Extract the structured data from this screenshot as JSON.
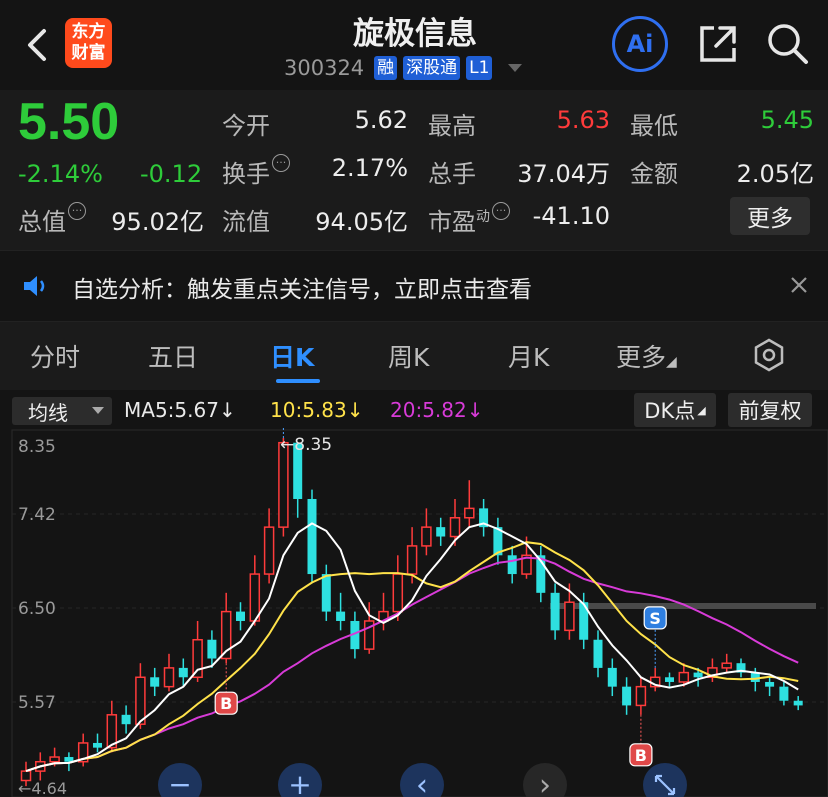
{
  "header": {
    "title": "旋极信息",
    "code": "300324",
    "tags": [
      "融",
      "深股通",
      "L1"
    ],
    "logo_lines": [
      "东方",
      "财富"
    ],
    "ai_label": "Ai"
  },
  "quote": {
    "price": "5.50",
    "change_pct": "-2.14%",
    "change_amt": "-0.12",
    "open_label": "今开",
    "open": "5.62",
    "high_label": "最高",
    "high": "5.63",
    "low_label": "最低",
    "low": "5.45",
    "turnover_label": "换手",
    "turnover": "2.17%",
    "volume_label": "总手",
    "volume": "37.04万",
    "amount_label": "金额",
    "amount": "2.05亿",
    "mcap_label": "总值",
    "mcap": "95.02亿",
    "float_label": "流值",
    "float": "94.05亿",
    "pe_label": "市盈",
    "pe_sup": "动",
    "pe": "-41.10",
    "more_label": "更多"
  },
  "banner": {
    "text": "自选分析：触发重点关注信号，立即点击查看"
  },
  "tabs": [
    "分时",
    "五日",
    "日K",
    "周K",
    "月K",
    "更多"
  ],
  "active_tab": "日K",
  "ma_bar": {
    "mode": "均线",
    "ma5": "MA5:5.67",
    "ma10": "10:5.83",
    "ma20": "20:5.82",
    "dk": "DK点",
    "adjust": "前复权"
  },
  "colors": {
    "up": "#ff3b3b",
    "down": "#2ee0e0",
    "ma5": "#ffffff",
    "ma10": "#ffe24a",
    "ma20": "#d83bd8",
    "accent": "#2f8fff"
  },
  "chart_data": {
    "type": "candlestick",
    "y_ticks": [
      "8.35",
      "7.42",
      "6.50",
      "5.57"
    ],
    "ylim": [
      4.62,
      8.35
    ],
    "max_label": "8.35",
    "min_label": "4.64",
    "signals": [
      {
        "type": "B",
        "index": 14
      },
      {
        "type": "S",
        "index": 18
      },
      {
        "type": "B",
        "index": 43
      },
      {
        "type": "S",
        "index": 44
      }
    ],
    "candles": [
      [
        4.7,
        4.8,
        4.9,
        4.64
      ],
      [
        4.8,
        4.9,
        5.0,
        4.7
      ],
      [
        4.9,
        4.95,
        5.05,
        4.85
      ],
      [
        4.95,
        4.9,
        5.0,
        4.8
      ],
      [
        4.9,
        5.1,
        5.2,
        4.85
      ],
      [
        5.1,
        5.05,
        5.2,
        5.0
      ],
      [
        5.05,
        5.4,
        5.55,
        5.0
      ],
      [
        5.4,
        5.3,
        5.5,
        5.2
      ],
      [
        5.3,
        5.8,
        5.95,
        5.25
      ],
      [
        5.8,
        5.7,
        5.9,
        5.6
      ],
      [
        5.7,
        5.9,
        6.05,
        5.65
      ],
      [
        5.9,
        5.8,
        6.0,
        5.7
      ],
      [
        5.8,
        6.2,
        6.4,
        5.75
      ],
      [
        6.2,
        6.0,
        6.3,
        5.9
      ],
      [
        6.0,
        6.5,
        6.7,
        5.95
      ],
      [
        6.5,
        6.4,
        6.6,
        6.3
      ],
      [
        6.4,
        6.9,
        7.1,
        6.35
      ],
      [
        6.9,
        7.4,
        7.6,
        6.8
      ],
      [
        7.4,
        8.3,
        8.35,
        7.3
      ],
      [
        8.3,
        7.7,
        8.1,
        7.5
      ],
      [
        7.7,
        6.9,
        7.8,
        6.8
      ],
      [
        6.9,
        6.5,
        7.0,
        6.4
      ],
      [
        6.5,
        6.4,
        6.7,
        6.3
      ],
      [
        6.4,
        6.1,
        6.5,
        6.0
      ],
      [
        6.1,
        6.4,
        6.6,
        6.05
      ],
      [
        6.4,
        6.5,
        6.7,
        6.3
      ],
      [
        6.5,
        6.9,
        7.1,
        6.4
      ],
      [
        6.9,
        7.2,
        7.4,
        6.8
      ],
      [
        7.2,
        7.4,
        7.6,
        7.1
      ],
      [
        7.4,
        7.3,
        7.5,
        7.2
      ],
      [
        7.3,
        7.5,
        7.7,
        7.2
      ],
      [
        7.5,
        7.6,
        7.9,
        7.4
      ],
      [
        7.6,
        7.4,
        7.7,
        7.3
      ],
      [
        7.4,
        7.1,
        7.5,
        7.0
      ],
      [
        7.1,
        6.9,
        7.2,
        6.8
      ],
      [
        6.9,
        7.1,
        7.3,
        6.85
      ],
      [
        7.1,
        6.7,
        7.2,
        6.6
      ],
      [
        6.7,
        6.3,
        6.8,
        6.2
      ],
      [
        6.3,
        6.6,
        6.8,
        6.2
      ],
      [
        6.6,
        6.2,
        6.7,
        6.1
      ],
      [
        6.2,
        5.9,
        6.3,
        5.8
      ],
      [
        5.9,
        5.7,
        6.0,
        5.6
      ],
      [
        5.7,
        5.5,
        5.8,
        5.4
      ],
      [
        5.5,
        5.7,
        5.8,
        5.4
      ],
      [
        5.7,
        5.8,
        5.9,
        5.65
      ],
      [
        5.8,
        5.75,
        5.85,
        5.7
      ],
      [
        5.75,
        5.85,
        5.95,
        5.7
      ],
      [
        5.85,
        5.8,
        5.9,
        5.7
      ],
      [
        5.8,
        5.9,
        6.0,
        5.75
      ],
      [
        5.9,
        5.95,
        6.05,
        5.85
      ],
      [
        5.95,
        5.85,
        6.0,
        5.8
      ],
      [
        5.85,
        5.75,
        5.9,
        5.65
      ],
      [
        5.75,
        5.7,
        5.8,
        5.6
      ],
      [
        5.7,
        5.55,
        5.75,
        5.5
      ],
      [
        5.55,
        5.5,
        5.6,
        5.45
      ]
    ]
  },
  "controls": {
    "zoom_out": "−",
    "zoom_in": "+",
    "prev": "‹",
    "next": "›"
  }
}
